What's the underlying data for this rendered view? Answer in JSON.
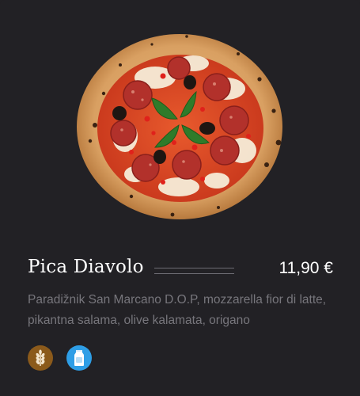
{
  "menu_item": {
    "title": "Pica Diavolo",
    "price": "11,90 €",
    "description": "Paradižnik San Marcano D.O.P, mozzarella fior di latte, pikantna salama, olive kalamata, origano",
    "image_icon": "pizza-image"
  },
  "allergens": [
    {
      "icon": "wheat-icon",
      "meaning": "gluten",
      "color": "#8b5a1b"
    },
    {
      "icon": "milk-icon",
      "meaning": "milk",
      "color": "#2e9ee6"
    }
  ],
  "colors": {
    "background": "#222125",
    "title": "#ffffff",
    "description": "#77767c",
    "divider": "#6e6d74"
  }
}
